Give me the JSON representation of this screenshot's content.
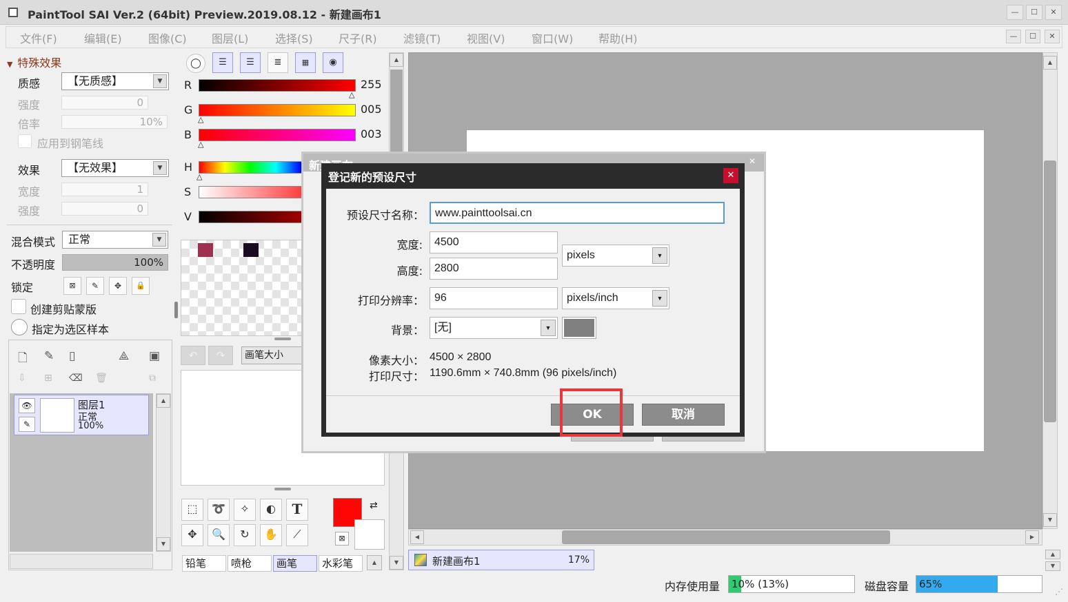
{
  "window": {
    "title": "PaintTool SAI Ver.2 (64bit) Preview.2019.08.12 - 新建画布1",
    "minimize": "—",
    "maximize": "☐",
    "close": "✕"
  },
  "menu": [
    "文件(F)",
    "编辑(E)",
    "图像(C)",
    "图层(L)",
    "选择(S)",
    "尺子(R)",
    "滤镜(T)",
    "视图(V)",
    "窗口(W)",
    "帮助(H)"
  ],
  "effects": {
    "section": "特殊效果",
    "texture_label": "质感",
    "texture_value": "【无质感】",
    "strength_label": "强度",
    "strength_value": "0",
    "scale_label": "倍率",
    "scale_value": "10%",
    "apply_pen": "应用到钢笔线",
    "effect_label": "效果",
    "effect_value": "【无效果】",
    "width_label": "宽度",
    "width_value": "1",
    "strength2_label": "强度",
    "strength2_value": "0"
  },
  "layer_props": {
    "blend_label": "混合模式",
    "blend_value": "正常",
    "opacity_label": "不透明度",
    "opacity_value": "100%",
    "opacity_level": 1.0,
    "lock_label": "锁定",
    "clip_label": "创建剪贴蒙版",
    "selection_label": "指定为选区样本"
  },
  "layer": {
    "name": "图层1",
    "mode": "正常",
    "opacity": "100%"
  },
  "color": {
    "r_label": "R",
    "r_value": "255",
    "g_label": "G",
    "g_value": "005",
    "b_label": "B",
    "b_value": "003",
    "h_label": "H",
    "s_label": "S",
    "v_label": "V",
    "current": "#ff0503",
    "swatch1": "#a0304f",
    "swatch2": "#1a0a22"
  },
  "brush": {
    "size_label": "画笔大小",
    "tabs": [
      "铅笔",
      "喷枪",
      "画笔",
      "水彩笔"
    ]
  },
  "canvas_tab": {
    "name": "新建画布1",
    "zoom": "17%"
  },
  "status": {
    "mem_label": "内存使用量",
    "mem_value": "10% (13%)",
    "mem_level": 0.1,
    "disk_label": "磁盘容量",
    "disk_value": "65%",
    "disk_level": 0.65
  },
  "back_dialog": {
    "title": "新建画布",
    "close": "✕"
  },
  "dialog": {
    "title": "登记新的预设尺寸",
    "close": "✕",
    "name_label": "预设尺寸名称：",
    "name_value": "www.painttoolsai.cn",
    "width_label": "宽度:",
    "width_value": "4500",
    "height_label": "高度:",
    "height_value": "2800",
    "unit": "pixels",
    "res_label": "打印分辨率：",
    "res_value": "96",
    "res_unit": "pixels/inch",
    "bg_label": "背景：",
    "bg_value": "[无]",
    "bg_color": "#808080",
    "pixel_size_label": "像素大小：",
    "pixel_size_value": "4500 × 2800",
    "print_size_label": "打印尺寸：",
    "print_size_value": "1190.6mm × 740.8mm (96 pixels/inch)",
    "ok": "OK",
    "cancel": "取消"
  }
}
